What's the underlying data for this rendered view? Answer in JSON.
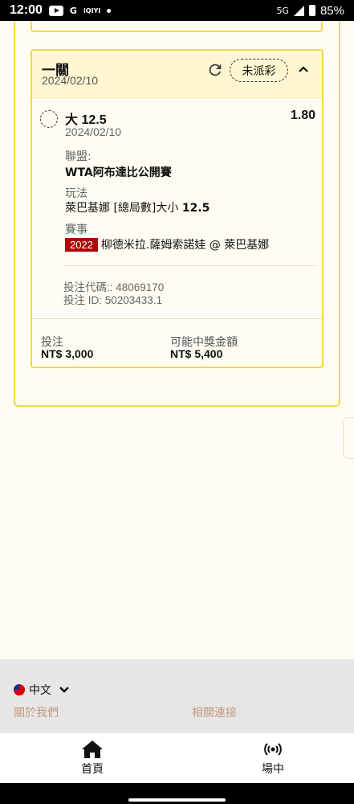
{
  "status_bar": {
    "time": "12:00",
    "battery_pct": "85%",
    "network": "5G",
    "app_icons": [
      "youtube-icon",
      "google-icon",
      "iqiyi-icon",
      "dot-icon"
    ]
  },
  "bet_card": {
    "bet_type": "一關",
    "date": "2024/02/10",
    "status": "未派彩",
    "selection": {
      "name": "大 12.5",
      "odds": "1.80",
      "date": "2024/02/10"
    },
    "league_label": "聯盟:",
    "league_value": "WTA阿布達比公開賽",
    "market_label": "玩法",
    "market_value_prefix": "萊巴基娜 [總局數]大小 ",
    "market_value_line": "12.5",
    "event_label": "賽事",
    "event_year": "2022",
    "event_value": "柳德米拉.薩姆索諾娃 @ 萊巴基娜",
    "bet_code": "投注代碼:: 48069170",
    "bet_id": "投注 ID: 50203433.1",
    "stake_label": "投注",
    "stake_value": "NT$ 3,000",
    "payout_label": "可能中獎金額",
    "payout_value": "NT$ 5,400"
  },
  "footer": {
    "language": "中文",
    "about_link": "關於我們",
    "links_link": "相關連接"
  },
  "bottom_nav": {
    "home_label": "首頁",
    "live_label": "場中"
  },
  "colors": {
    "card_border": "#F2DA3F",
    "card_header_bg": "#FFF6D2",
    "page_bg": "#FFFDF3",
    "year_badge": "#B30000",
    "footer_link": "#C49A82"
  }
}
